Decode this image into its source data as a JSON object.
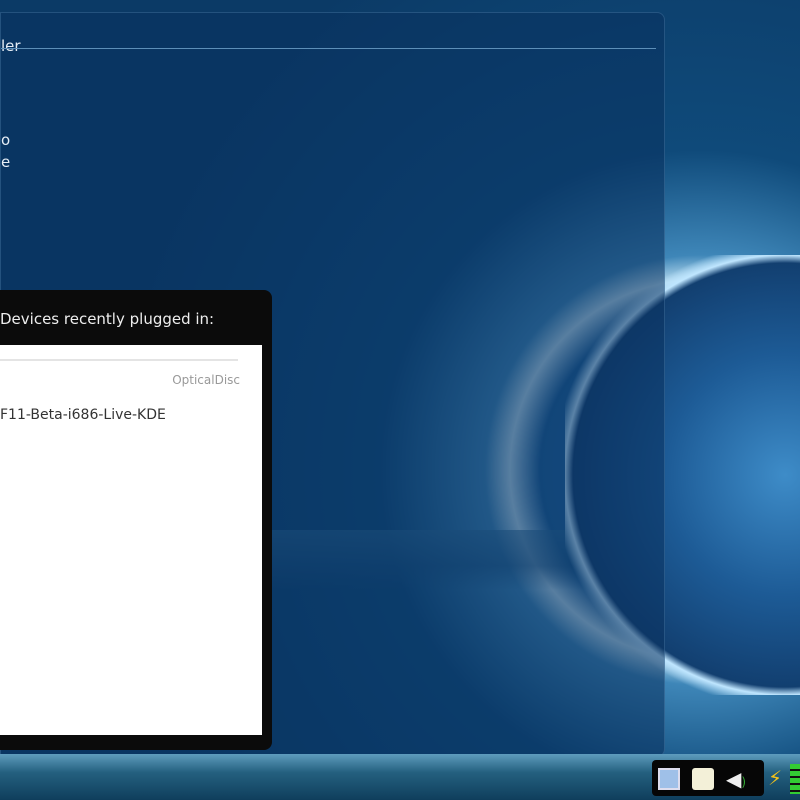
{
  "folder_view": {
    "title_partial": "ler",
    "menu_items_partial": [
      "o",
      "e"
    ]
  },
  "device_notifier": {
    "title": "Devices recently plugged in:",
    "device_type": "OpticalDisc",
    "device_name": "F11-Beta-i686-Live-KDE"
  },
  "system_tray": {
    "icons": [
      "network-icon",
      "clipboard-icon",
      "volume-icon",
      "battery-icon"
    ]
  }
}
